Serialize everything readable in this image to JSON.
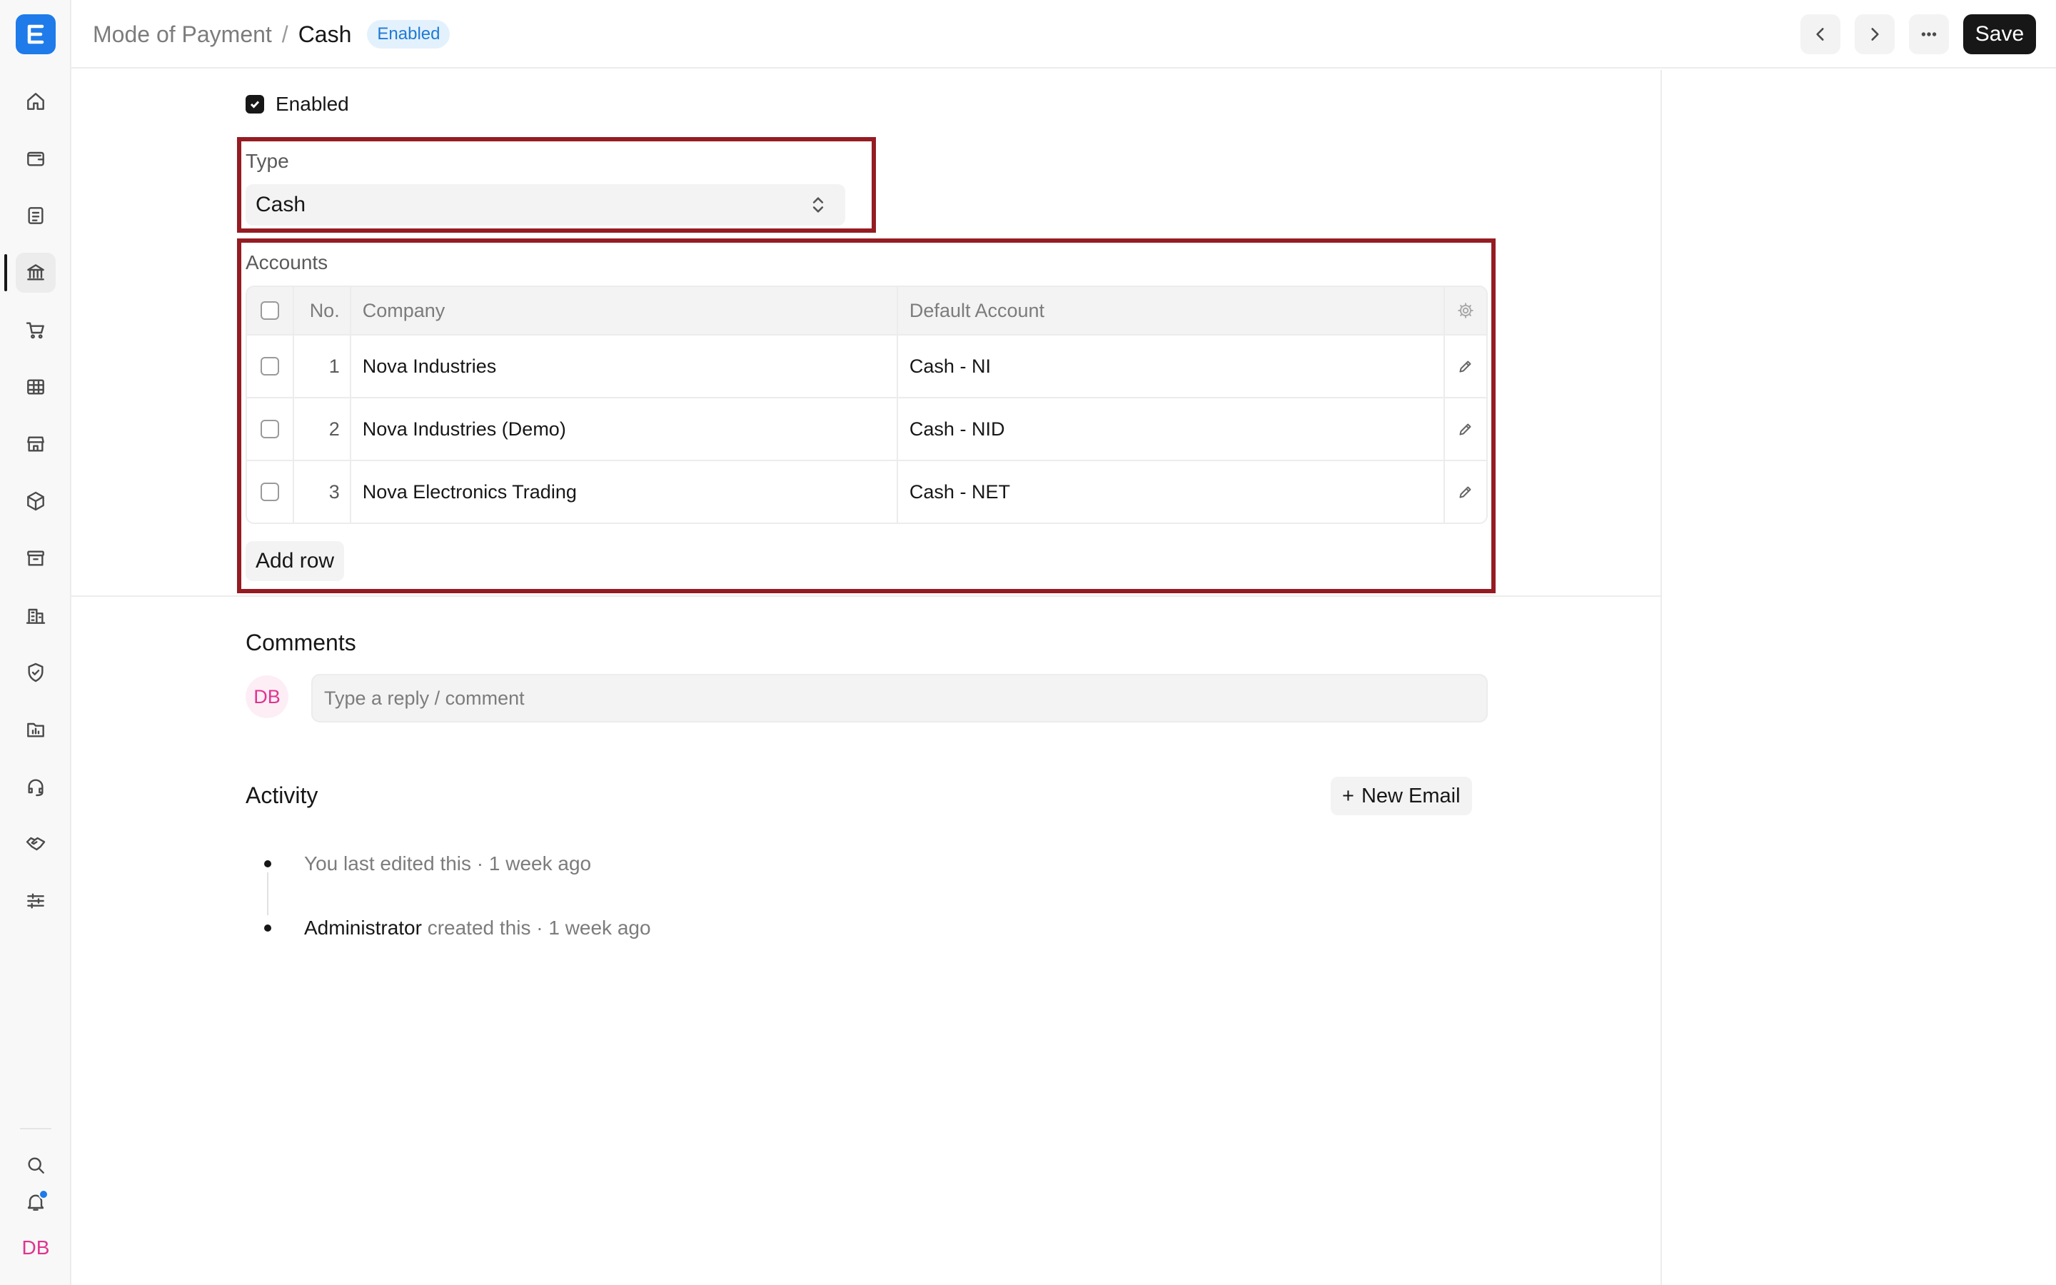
{
  "header": {
    "parent": "Mode of Payment",
    "separator": "/",
    "title": "Cash",
    "status": "Enabled",
    "save_label": "Save"
  },
  "form": {
    "enabled_label": "Enabled",
    "enabled_checked": true,
    "type_label": "Type",
    "type_value": "Cash",
    "accounts_label": "Accounts",
    "columns": {
      "no": "No.",
      "company": "Company",
      "default_account": "Default Account"
    },
    "rows": [
      {
        "no": "1",
        "company": "Nova Industries",
        "account": "Cash - NI"
      },
      {
        "no": "2",
        "company": "Nova Industries (Demo)",
        "account": "Cash - NID"
      },
      {
        "no": "3",
        "company": "Nova Electronics Trading",
        "account": "Cash - NET"
      }
    ],
    "add_row_label": "Add row"
  },
  "comments": {
    "title": "Comments",
    "avatar_initials": "DB",
    "placeholder": "Type a reply / comment"
  },
  "activity": {
    "title": "Activity",
    "new_email_label": "New Email",
    "items": [
      {
        "who": "",
        "text": "You last edited this · 1 week ago"
      },
      {
        "who": "Administrator",
        "text": " created this · 1 week ago"
      }
    ]
  },
  "sidebar": {
    "avatar_initials": "DB",
    "icons": [
      "home-icon",
      "wallet-icon",
      "document-icon",
      "bank-icon",
      "cart-icon",
      "table-icon",
      "store-icon",
      "package-icon",
      "archive-icon",
      "building-icon",
      "shield-icon",
      "folder-chart-icon",
      "headset-icon",
      "handshake-icon",
      "sliders-icon",
      "search-icon",
      "bell-icon"
    ]
  },
  "colors": {
    "highlight": "#951c22",
    "brand": "#1e7be9",
    "badge_text": "#1f7bd3",
    "avatar": "#e0358f"
  }
}
